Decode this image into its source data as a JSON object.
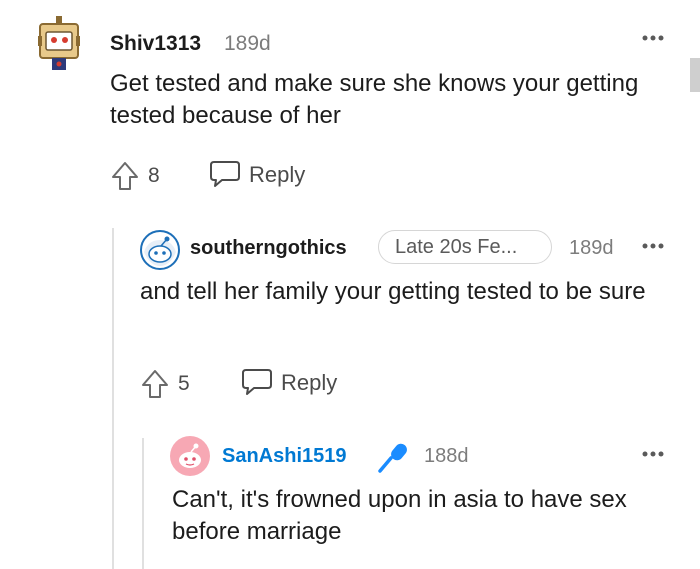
{
  "comments": [
    {
      "username": "Shiv1313",
      "age": "189d",
      "body": "Get tested and make sure she knows your getting tested because of her",
      "upvotes": "8",
      "reply_label": "Reply",
      "avatar": "snoo-box-avatar-icon"
    },
    {
      "username": "southerngothics",
      "flair": "Late 20s Fe...",
      "age": "189d",
      "body": "and tell her family your getting tested to be sure",
      "upvotes": "5",
      "reply_label": "Reply",
      "avatar": "snoo-default-avatar-icon"
    },
    {
      "username": "SanAshi1519",
      "age": "188d",
      "body": "Can't, it's frowned upon in asia to have sex before marriage",
      "avatar": "snoo-pink-avatar-icon",
      "badge": "microphone-icon"
    }
  ],
  "colors": {
    "username_link": "#0079d3",
    "meta_gray": "#7c7c7c",
    "mic_blue": "#1a8cff",
    "pink_avatar": "#f7a8b4"
  }
}
